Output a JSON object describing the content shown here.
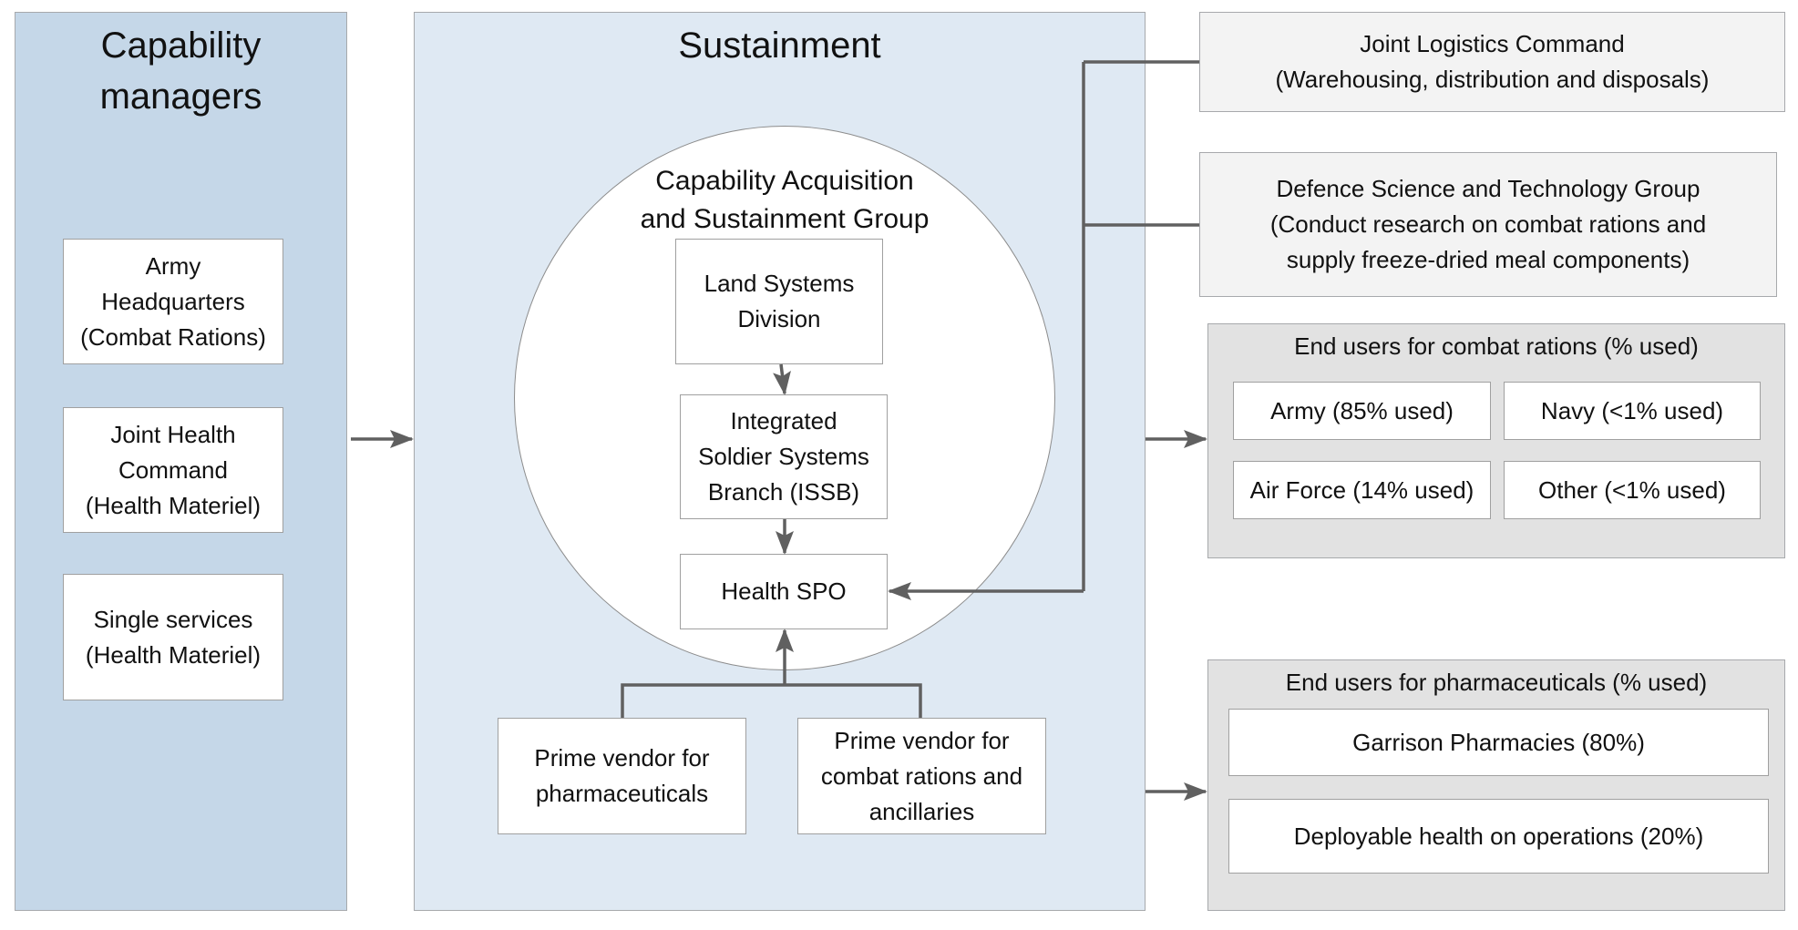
{
  "capability_managers": {
    "title": "Capability\nmanagers",
    "items": [
      {
        "label": "Army\nHeadquarters\n(Combat Rations)"
      },
      {
        "label": "Joint Health\nCommand\n(Health Materiel)"
      },
      {
        "label": "Single services\n(Health Materiel)"
      }
    ]
  },
  "sustainment": {
    "title": "Sustainment",
    "casg": {
      "title": "Capability Acquisition\nand Sustainment Group",
      "land_systems": "Land Systems\nDivision",
      "issb": "Integrated\nSoldier Systems\nBranch (ISSB)",
      "health_spo": "Health SPO"
    },
    "vendors": [
      {
        "label": "Prime vendor for\npharmaceuticals"
      },
      {
        "label": "Prime vendor for\ncombat rations and\nancillaries"
      }
    ]
  },
  "support": {
    "jlc": "Joint Logistics Command\n(Warehousing, distribution and disposals)",
    "dstg": "Defence Science and Technology Group\n(Conduct research on combat rations and\nsupply freeze-dried meal components)"
  },
  "end_users_rations": {
    "title": "End users for combat rations (% used)",
    "items": [
      {
        "label": "Army (85% used)",
        "percent": "85%"
      },
      {
        "label": "Navy (<1% used)",
        "percent": "<1%"
      },
      {
        "label": "Air Force (14% used)",
        "percent": "14%"
      },
      {
        "label": "Other (<1% used)",
        "percent": "<1%"
      }
    ]
  },
  "end_users_pharma": {
    "title": "End users for pharmaceuticals (% used)",
    "items": [
      {
        "label": "Garrison Pharmacies (80%)",
        "percent": "80%"
      },
      {
        "label": "Deployable health on operations (20%)",
        "percent": "20%"
      }
    ]
  },
  "colors": {
    "capability_panel": "#c5d7e8",
    "sustainment_panel": "#dfe9f3",
    "end_user_group": "#e2e2e2",
    "support_box": "#f3f3f3",
    "connector": "#606060"
  }
}
